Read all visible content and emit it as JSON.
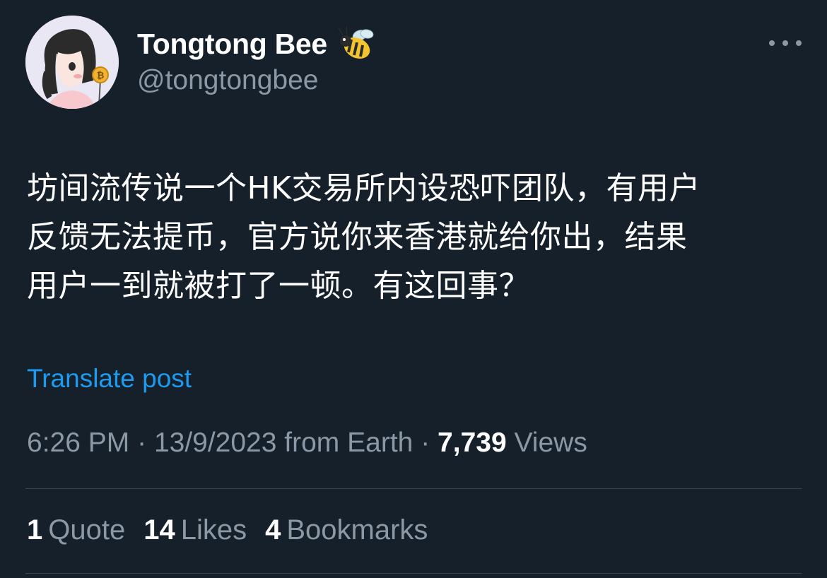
{
  "user": {
    "display_name": "Tongtong Bee",
    "handle": "@tongtongbee",
    "badge_icon": "bee-emoji-icon",
    "avatar_icon": "avatar-girl-bitcoin-icon"
  },
  "menu": {
    "icon": "more-horizontal-icon"
  },
  "tweet": {
    "lines": [
      "坊间流传说一个HK交易所内设恐吓团队，有用户",
      "反馈无法提币，官方说你来香港就给你出，结果",
      "用户一到就被打了一顿。有这回事？"
    ],
    "translate_label": "Translate post"
  },
  "meta": {
    "time": "6:26 PM",
    "separator": "·",
    "date": "13/9/2023",
    "location": "from Earth",
    "views_count": "7,739",
    "views_label": "Views"
  },
  "stats": [
    {
      "count": "1",
      "label": "Quote"
    },
    {
      "count": "14",
      "label": "Likes"
    },
    {
      "count": "4",
      "label": "Bookmarks"
    }
  ],
  "colors": {
    "background": "#15202b",
    "text": "#ffffff",
    "secondary": "#8b98a5",
    "accent": "#1d9bf0",
    "divider": "#38444d"
  }
}
